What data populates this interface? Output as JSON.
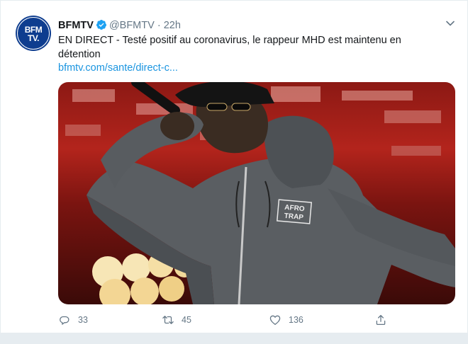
{
  "tweet": {
    "author_name": "BFMTV",
    "handle": "@BFMTV",
    "separator": "·",
    "time": "22h",
    "text": "EN DIRECT - Testé positif au coronavirus, le rappeur MHD est maintenu en détention",
    "link": "bfmtv.com/sante/direct-c...",
    "avatar_lines": [
      "BFM",
      "TV."
    ],
    "image_alt": "Rapper performing on stage with microphone, wearing grey hoodie with AFRO TRAP print",
    "hoodie_print": [
      "AFRO",
      "TRAP"
    ]
  },
  "actions": {
    "reply_count": "33",
    "retweet_count": "45",
    "like_count": "136"
  },
  "colors": {
    "link": "#1b95e0",
    "secondary_text": "#657786",
    "verified": "#1da1f2",
    "avatar_bg": "#0e3d8f"
  }
}
